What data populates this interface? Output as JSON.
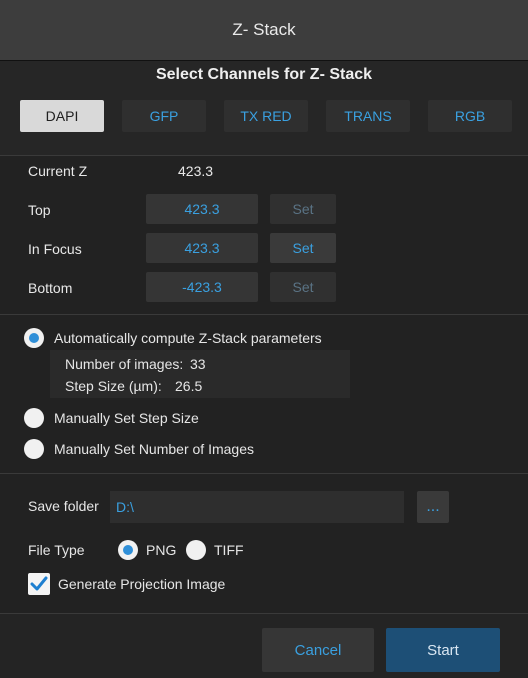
{
  "window": {
    "title": "Z- Stack"
  },
  "channels": {
    "section_title": "Select Channels for Z- Stack",
    "items": [
      "DAPI",
      "GFP",
      "TX RED",
      "TRANS",
      "RGB"
    ],
    "active": "DAPI"
  },
  "z": {
    "current_label": "Current Z",
    "current_value": "423.3",
    "top_label": "Top",
    "top_value": "423.3",
    "in_focus_label": "In Focus",
    "in_focus_value": "423.3",
    "bottom_label": "Bottom",
    "bottom_value": "-423.3",
    "set_label": "Set"
  },
  "mode": {
    "auto_label": "Automatically compute Z-Stack parameters",
    "num_images_label": "Number of images:",
    "num_images_value": "33",
    "step_size_label": "Step Size (µm):",
    "step_size_value": "26.5",
    "manual_step_label": "Manually Set Step Size",
    "manual_images_label": "Manually Set Number of Images",
    "selected": "auto"
  },
  "save": {
    "folder_label": "Save folder",
    "folder_value": "D:\\",
    "browse_label": "..."
  },
  "file_type": {
    "label": "File Type",
    "png_label": "PNG",
    "tiff_label": "TIFF",
    "selected": "PNG"
  },
  "projection": {
    "label": "Generate Projection Image",
    "checked": true
  },
  "buttons": {
    "cancel": "Cancel",
    "start": "Start"
  },
  "colors": {
    "accent": "#3aa0e0",
    "start_bg": "#1d4f76",
    "background": "#222222"
  }
}
